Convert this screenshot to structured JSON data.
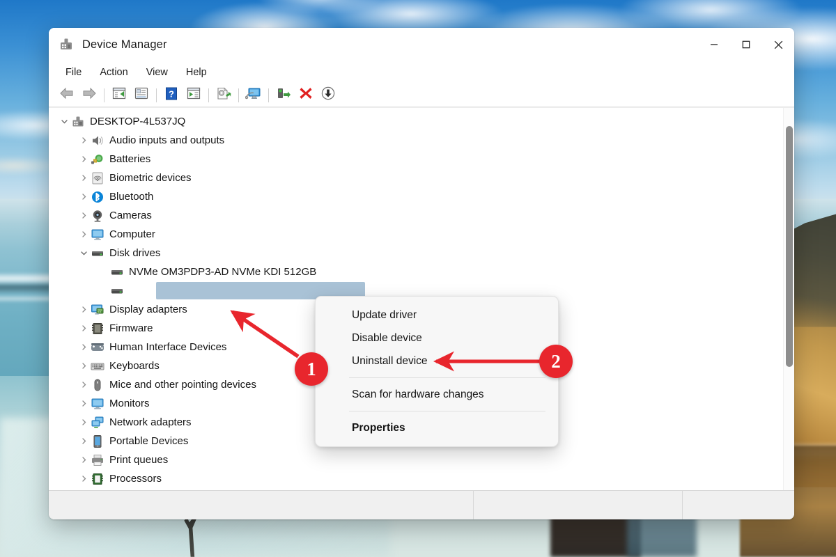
{
  "window": {
    "title": "Device Manager",
    "title_icon": "device-manager-icon",
    "controls": {
      "minimize": "minimize-button",
      "maximize": "maximize-button",
      "close": "close-button"
    }
  },
  "menubar": {
    "items": [
      {
        "label": "File",
        "name": "menu-file"
      },
      {
        "label": "Action",
        "name": "menu-action"
      },
      {
        "label": "View",
        "name": "menu-view"
      },
      {
        "label": "Help",
        "name": "menu-help"
      }
    ]
  },
  "toolbar": {
    "buttons": [
      {
        "name": "back-button",
        "icon": "back-arrow-icon"
      },
      {
        "name": "forward-button",
        "icon": "forward-arrow-icon"
      },
      {
        "name": "show-hide-console-tree-button",
        "icon": "console-tree-icon"
      },
      {
        "name": "properties-button",
        "icon": "properties-icon"
      },
      {
        "name": "help-button",
        "icon": "help-question-icon"
      },
      {
        "name": "show-hide-action-pane-button",
        "icon": "action-pane-icon"
      },
      {
        "name": "update-driver-button",
        "icon": "update-driver-icon"
      },
      {
        "name": "scan-for-hardware-changes-button",
        "icon": "scan-monitor-icon"
      },
      {
        "name": "enable-device-button",
        "icon": "enable-device-icon"
      },
      {
        "name": "uninstall-device-button",
        "icon": "red-x-icon"
      },
      {
        "name": "download-button",
        "icon": "download-arrow-icon"
      }
    ]
  },
  "tree": {
    "root": {
      "label": "DESKTOP-4L537JQ",
      "icon": "computer-root-icon",
      "expanded": true,
      "chevron": "chevron-down"
    },
    "items": [
      {
        "label": "Audio inputs and outputs",
        "icon": "speaker-icon",
        "level": 1,
        "chevron": "chevron-right"
      },
      {
        "label": "Batteries",
        "icon": "battery-icon",
        "level": 1,
        "chevron": "chevron-right"
      },
      {
        "label": "Biometric devices",
        "icon": "fingerprint-icon",
        "level": 1,
        "chevron": "chevron-right"
      },
      {
        "label": "Bluetooth",
        "icon": "bluetooth-icon",
        "level": 1,
        "chevron": "chevron-right"
      },
      {
        "label": "Cameras",
        "icon": "camera-icon",
        "level": 1,
        "chevron": "chevron-right"
      },
      {
        "label": "Computer",
        "icon": "monitor-icon",
        "level": 1,
        "chevron": "chevron-right"
      },
      {
        "label": "Disk drives",
        "icon": "disk-drive-icon",
        "level": 1,
        "chevron": "chevron-down"
      },
      {
        "label": "NVMe OM3PDP3-AD NVMe KDI 512GB",
        "icon": "disk-drive-icon",
        "level": 2,
        "chevron": ""
      },
      {
        "label": "",
        "icon": "disk-drive-icon",
        "level": 2,
        "chevron": "",
        "selected": true,
        "redacted": true
      },
      {
        "label": "Display adapters",
        "icon": "display-adapter-icon",
        "level": 1,
        "chevron": "chevron-right"
      },
      {
        "label": "Firmware",
        "icon": "firmware-chip-icon",
        "level": 1,
        "chevron": "chevron-right"
      },
      {
        "label": "Human Interface Devices",
        "icon": "hid-gamepad-icon",
        "level": 1,
        "chevron": "chevron-right"
      },
      {
        "label": "Keyboards",
        "icon": "keyboard-icon",
        "level": 1,
        "chevron": "chevron-right"
      },
      {
        "label": "Mice and other pointing devices",
        "icon": "mouse-icon",
        "level": 1,
        "chevron": "chevron-right"
      },
      {
        "label": "Monitors",
        "icon": "monitor-icon",
        "level": 1,
        "chevron": "chevron-right"
      },
      {
        "label": "Network adapters",
        "icon": "network-adapter-icon",
        "level": 1,
        "chevron": "chevron-right"
      },
      {
        "label": "Portable Devices",
        "icon": "portable-device-icon",
        "level": 1,
        "chevron": "chevron-right"
      },
      {
        "label": "Print queues",
        "icon": "printer-icon",
        "level": 1,
        "chevron": "chevron-right"
      },
      {
        "label": "Processors",
        "icon": "processor-icon",
        "level": 1,
        "chevron": "chevron-right"
      }
    ]
  },
  "context_menu": {
    "items": [
      {
        "label": "Update driver",
        "name": "ctx-update-driver",
        "bold": false
      },
      {
        "label": "Disable device",
        "name": "ctx-disable-device",
        "bold": false
      },
      {
        "label": "Uninstall device",
        "name": "ctx-uninstall-device",
        "bold": false
      },
      {
        "separator": true
      },
      {
        "label": "Scan for hardware changes",
        "name": "ctx-scan-for-hardware-changes",
        "bold": false
      },
      {
        "separator": true
      },
      {
        "label": "Properties",
        "name": "ctx-properties",
        "bold": true
      }
    ]
  },
  "annotations": {
    "marker_one": "1",
    "marker_two": "2",
    "color": "#e8262d"
  },
  "scrollbar": {
    "name": "vertical-scrollbar"
  },
  "statusbar": {
    "text": ""
  }
}
